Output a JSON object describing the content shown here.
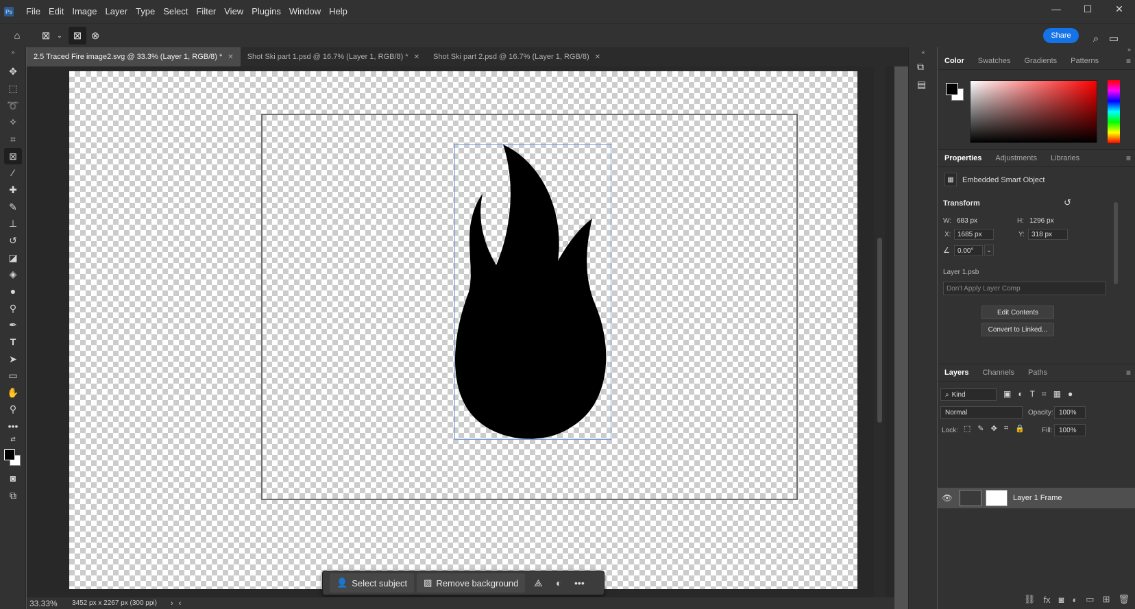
{
  "app": {
    "logo": "Ps"
  },
  "menu": [
    "File",
    "Edit",
    "Image",
    "Layer",
    "Type",
    "Select",
    "Filter",
    "View",
    "Plugins",
    "Window",
    "Help"
  ],
  "window_controls": {
    "minimize": "—",
    "maximize": "☐",
    "close": "✕"
  },
  "options_bar": {
    "share_label": "Share"
  },
  "tabs": [
    {
      "label": "2.5 Traced Fire image2.svg @ 33.3% (Layer 1, RGB/8) *",
      "active": true
    },
    {
      "label": "Shot Ski part 1.psd @ 16.7% (Layer 1, RGB/8) *",
      "active": false
    },
    {
      "label": "Shot Ski part 2.psd @ 16.7% (Layer 1, RGB/8)",
      "active": false
    }
  ],
  "taskbar": {
    "select_subject": "Select subject",
    "remove_background": "Remove background",
    "more": "•••"
  },
  "status": {
    "zoom": "33.33%",
    "doc_info": "3452 px x 2267 px (300 ppi)"
  },
  "color_panel": {
    "tabs": [
      "Color",
      "Swatches",
      "Gradients",
      "Patterns"
    ],
    "foreground": "#000000",
    "background": "#ffffff"
  },
  "properties": {
    "tabs": [
      "Properties",
      "Adjustments",
      "Libraries"
    ],
    "object_type": "Embedded Smart Object",
    "section": "Transform",
    "w_label": "W:",
    "w_value": "683 px",
    "h_label": "H:",
    "h_value": "1296 px",
    "x_label": "X:",
    "x_value": "1685 px",
    "y_label": "Y:",
    "y_value": "318 px",
    "angle": "0.00°",
    "file_name": "Layer 1.psb",
    "layer_comp": "Don't Apply Layer Comp",
    "edit_contents": "Edit Contents",
    "convert_linked": "Convert to Linked..."
  },
  "layers": {
    "tabs": [
      "Layers",
      "Channels",
      "Paths"
    ],
    "filter_kind": "Kind",
    "blend_mode": "Normal",
    "opacity_label": "Opacity:",
    "opacity_value": "100%",
    "lock_label": "Lock:",
    "fill_label": "Fill:",
    "fill_value": "100%",
    "items": [
      {
        "name": "Layer 1 Frame",
        "visible": true,
        "selected": true
      }
    ]
  },
  "colors": {
    "accent": "#1473e6",
    "selection_outline": "#6d9ee0"
  }
}
